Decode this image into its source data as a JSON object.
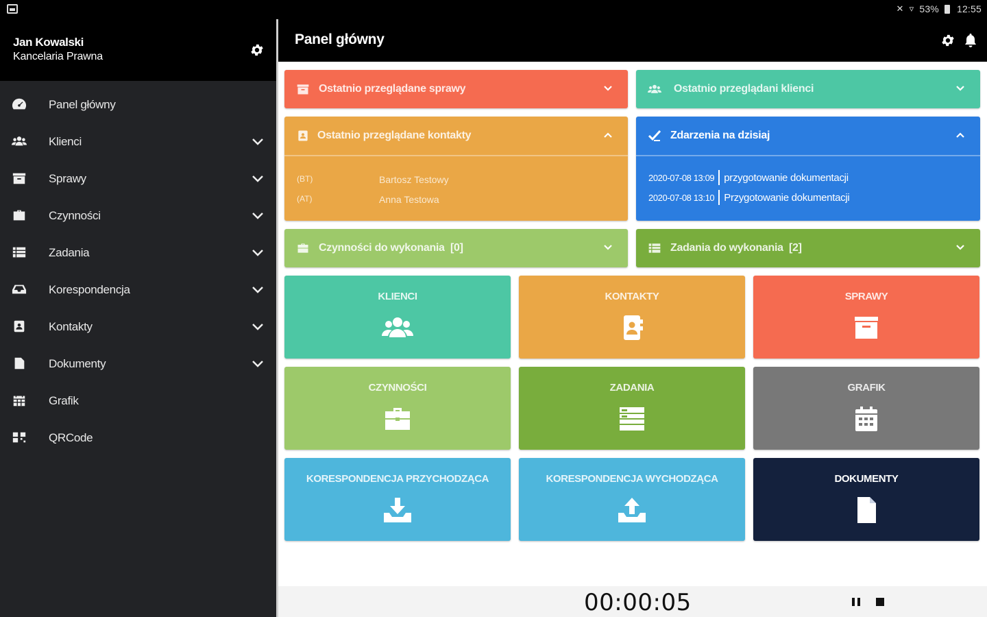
{
  "status_bar": {
    "battery": "53%",
    "time": "12:55"
  },
  "sidebar": {
    "user_name": "Jan Kowalski",
    "office_name": "Kancelaria Prawna",
    "items": [
      {
        "label": "Panel główny",
        "icon": "dashboard-icon",
        "has_chevron": false
      },
      {
        "label": "Klienci",
        "icon": "users-icon",
        "has_chevron": true
      },
      {
        "label": "Sprawy",
        "icon": "archive-icon",
        "has_chevron": true
      },
      {
        "label": "Czynności",
        "icon": "briefcase-icon",
        "has_chevron": true
      },
      {
        "label": "Zadania",
        "icon": "list-icon",
        "has_chevron": true
      },
      {
        "label": "Korespondencja",
        "icon": "inbox-icon",
        "has_chevron": true
      },
      {
        "label": "Kontakty",
        "icon": "contact-book-icon",
        "has_chevron": true
      },
      {
        "label": "Dokumenty",
        "icon": "document-icon",
        "has_chevron": true
      },
      {
        "label": "Grafik",
        "icon": "calendar-icon",
        "has_chevron": false
      },
      {
        "label": "QRCode",
        "icon": "qrcode-icon",
        "has_chevron": false
      }
    ]
  },
  "header": {
    "title": "Panel główny"
  },
  "panels": {
    "recent_cases": {
      "label": "Ostatnio przeglądane sprawy",
      "color": "#f56b50"
    },
    "recent_clients": {
      "label": "Ostatnio przeglądani klienci",
      "color": "#4dc7a4"
    },
    "recent_contacts": {
      "label": "Ostatnio przeglądane kontakty",
      "color": "#eaa746",
      "rows": [
        {
          "abbr": "(BT)",
          "name": "Bartosz Testowy"
        },
        {
          "abbr": "(AT)",
          "name": "Anna Testowa"
        }
      ]
    },
    "today_events": {
      "label": "Zdarzenia na dzisiaj",
      "color": "#2b7de0",
      "rows": [
        {
          "time": "2020-07-08 13:09",
          "desc": "przygotowanie dokumentacji"
        },
        {
          "time": "2020-07-08 13:10",
          "desc": "Przygotowanie dokumentacji"
        }
      ]
    },
    "activities_todo": {
      "label": "Czynności do wykonania",
      "count": "[0]",
      "color": "#9dc96a"
    },
    "tasks_todo": {
      "label": "Zadania do wykonania",
      "count": "[2]",
      "color": "#79ad3d"
    }
  },
  "tiles": [
    {
      "label": "KLIENCI",
      "icon": "users-icon",
      "color": "#4dc7a4"
    },
    {
      "label": "KONTAKTY",
      "icon": "contact-book-icon",
      "color": "#eaa746"
    },
    {
      "label": "SPRAWY",
      "icon": "archive-icon",
      "color": "#f56b50"
    },
    {
      "label": "CZYNNOŚCI",
      "icon": "briefcase-icon",
      "color": "#9dc96a"
    },
    {
      "label": "ZADANIA",
      "icon": "list-icon",
      "color": "#79ad3d"
    },
    {
      "label": "GRAFIK",
      "icon": "calendar-icon",
      "color": "#787878"
    },
    {
      "label": "KORESPONDENCJA PRZYCHODZĄCA",
      "icon": "inbox-download-icon",
      "color": "#4eb6dc"
    },
    {
      "label": "KORESPONDENCJA WYCHODZĄCA",
      "icon": "inbox-upload-icon",
      "color": "#4eb6dc"
    },
    {
      "label": "DOKUMENTY",
      "icon": "document-icon",
      "color": "#14213d"
    }
  ],
  "timer": {
    "value": "00:00:05"
  }
}
